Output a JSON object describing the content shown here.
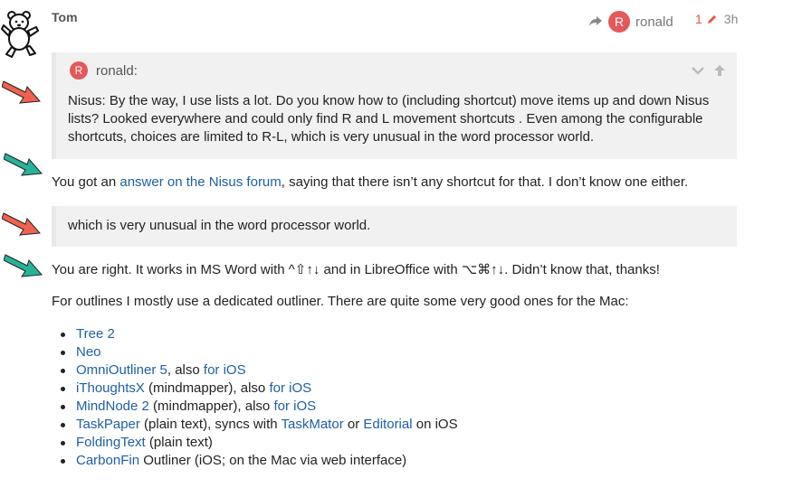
{
  "post": {
    "author": "Tom",
    "reply_to_user": "ronald",
    "reply_to_initial": "R",
    "edit_count": "1",
    "age": "3h"
  },
  "quote1": {
    "user": "ronald:",
    "initial": "R",
    "text": "Nisus: By the way, I use lists a lot. Do you know how to (including shortcut) move items up and down Nisus lists? Looked everywhere and could only find R and L movement shortcuts . Even among the configurable shortcuts, choices are limited to R-L, which is very unusual in the word processor world."
  },
  "para1": {
    "before": "You got an ",
    "link": "answer on the Nisus forum",
    "after": ", saying that there isn’t any shortcut for that. I don’t know one either."
  },
  "quote2": {
    "text": "which is very unusual in the word processor world."
  },
  "para2": {
    "text": "You are right. It works in MS Word with ^⇧↑↓ and in LibreOffice with ⌥⌘↑↓. Didn’t know that, thanks!"
  },
  "para3": {
    "text": "For outlines I mostly use a dedicated outliner. There are quite some very good ones for the Mac:"
  },
  "list": {
    "tree": {
      "link": "Tree 2"
    },
    "neo": {
      "link": "Neo"
    },
    "omni": {
      "link": "OmniOutliner 5",
      "t1": ", also ",
      "link2": "for iOS"
    },
    "ithoughts": {
      "link": "iThoughtsX",
      "t1": " (mindmapper), also ",
      "link2": "for iOS"
    },
    "mindnode": {
      "link": "MindNode 2",
      "t1": " (mindmapper), also ",
      "link2": "for iOS"
    },
    "taskpaper": {
      "link": "TaskPaper",
      "t1": " (plain text), syncs with ",
      "link2": "TaskMator",
      "t2": " or ",
      "link3": "Editorial",
      "t3": " on iOS"
    },
    "folding": {
      "link": "FoldingText",
      "t1": " (plain text)"
    },
    "carbon": {
      "link": "CarbonFin",
      "t1": " Outliner (iOS; on the Mac via web interface)"
    }
  },
  "colors": {
    "link": "#1f5fa3",
    "annotation_red": "#f0624f",
    "annotation_teal": "#27b39a",
    "avatar_red": "#e45858"
  },
  "icons": [
    "bear-avatar",
    "reply-arrow-icon",
    "pencil-icon",
    "chevron-down-icon",
    "arrow-up-icon",
    "annotation-arrow-icon"
  ]
}
